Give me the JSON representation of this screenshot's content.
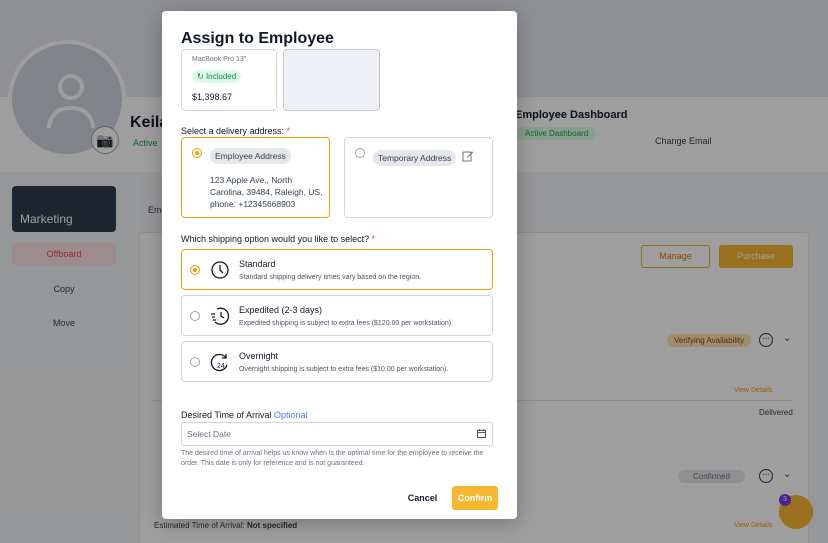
{
  "background": {
    "profile_name": "Keila",
    "profile_status": "Active",
    "dashboard_title": "Employee Dashboard",
    "dashboard_badge": "Active Dashboard",
    "change_email": "Change Email",
    "sidebar_card": "Marketing",
    "offboard": "Offboard",
    "copy": "Copy",
    "move": "Move",
    "tab": "Em",
    "manage": "Manage",
    "purchase": "Purchase",
    "verifying": "Verifying Availability",
    "confirmed": "Confirmed",
    "view_details": "View Details",
    "delivered": "Delivered",
    "eta_label": "Estimated Time of Arrival:",
    "eta_value": "Not specified",
    "fab_badge": "3"
  },
  "modal": {
    "title": "Assign to Employee",
    "product": {
      "cut_text": "MacBook Pro 13\"",
      "included": "Included",
      "price": "$1,398.67"
    },
    "delivery_label": "Select a delivery address:",
    "required_mark": "*",
    "addresses": [
      {
        "chip": "Employee Address",
        "text": "123 Apple Ave., North Carolina, 39484, Raleigh, US, phone: +12345668903",
        "selected": true
      },
      {
        "chip": "Temporary Address",
        "selected": false
      }
    ],
    "shipping_label": "Which shipping option would you like to select?",
    "shipping_options": [
      {
        "title": "Standard",
        "desc": "Standard shipping delivery times vary based on the region.",
        "selected": true
      },
      {
        "title": "Expedited (2-3 days)",
        "desc": "Expedited shipping is subject to extra fees ($120.00 per workstation).",
        "selected": false
      },
      {
        "title": "Overnight",
        "desc": "Overnight shipping is subject to extra fees ($10.00 per workstation).",
        "selected": false
      }
    ],
    "arrival_label": "Desired Time of Arrival",
    "arrival_optional": "Optional",
    "date_placeholder": "Select Date",
    "helper_text": "The desired time of arrival helps us know when is the optimal time for the employee to receive the order. This date is only for reference and is not guaranteed.",
    "cancel": "Cancel",
    "confirm": "Confirm"
  },
  "colors": {
    "accent": "#f7b731",
    "selected_border": "#f59e0b",
    "required": "#ef4444",
    "optional": "#3b82f6"
  }
}
